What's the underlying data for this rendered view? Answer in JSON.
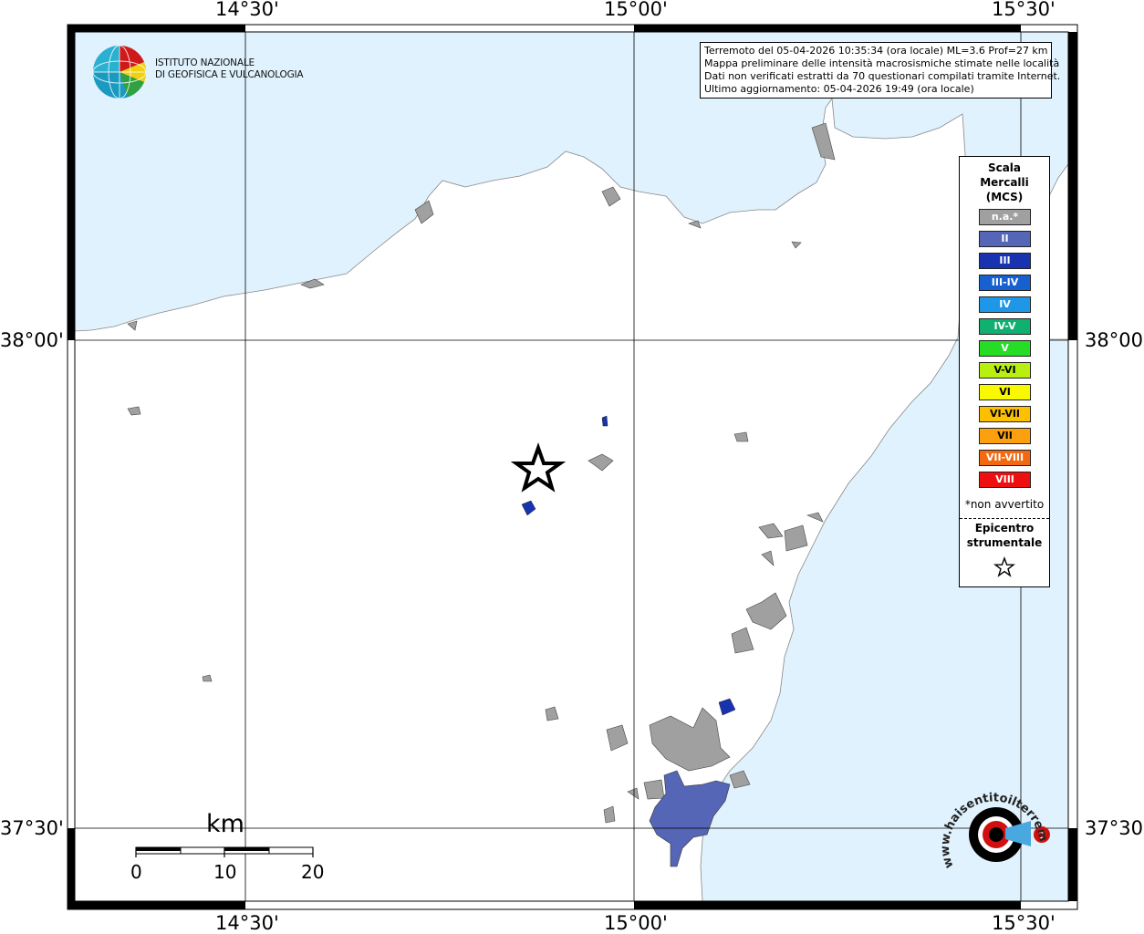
{
  "logo": {
    "line1": "ISTITUTO NAZIONALE",
    "line2": "DI GEOFISICA E VULCANOLOGIA"
  },
  "info": {
    "line1": "Terremoto del 05-04-2026 10:35:34 (ora locale) ML=3.6 Prof=27 km",
    "line2": "Mappa preliminare delle intensità macrosismiche stimate nelle località",
    "line3": "Dati non verificati estratti da 70 questionari compilati tramite Internet.",
    "line4": "Ultimo aggiornamento: 05-04-2026 19:49 (ora locale)"
  },
  "axes": {
    "top": [
      "14°30'",
      "15°00'",
      "15°30'"
    ],
    "bottom": [
      "14°30'",
      "15°00'",
      "15°30'"
    ],
    "left": [
      "38°00'",
      "37°30'"
    ],
    "right": [
      "38°00'",
      "37°30'"
    ]
  },
  "legend": {
    "title1": "Scala",
    "title2": "Mercalli",
    "title3": "(MCS)",
    "items": [
      {
        "label": "n.a.*",
        "color": "#a0a0a0"
      },
      {
        "label": "II",
        "color": "#5466b5"
      },
      {
        "label": "III",
        "color": "#1733b0"
      },
      {
        "label": "III-IV",
        "color": "#1660d0"
      },
      {
        "label": "IV",
        "color": "#1f97e8"
      },
      {
        "label": "IV-V",
        "color": "#10b070"
      },
      {
        "label": "V",
        "color": "#26dd26"
      },
      {
        "label": "V-VI",
        "color": "#b8ee10"
      },
      {
        "label": "VI",
        "color": "#f8f800"
      },
      {
        "label": "VI-VII",
        "color": "#fcc000"
      },
      {
        "label": "VII",
        "color": "#fca010"
      },
      {
        "label": "VII-VIII",
        "color": "#f46810"
      },
      {
        "label": "VIII",
        "color": "#ee1010"
      }
    ],
    "not_felt": "*non avvertito",
    "epicenter1": "Epicentro",
    "epicenter2": "strumentale"
  },
  "scale": {
    "unit": "km",
    "labels": [
      "0",
      "10",
      "20"
    ]
  },
  "watermark": {
    "text": "www.haisentitoilterremoto.it"
  },
  "colors": {
    "sea": "#e0f2fd",
    "land": "#ffffff",
    "not_available": "#a0a0a0",
    "intensity_II": "#5466b5",
    "intensity_III": "#1733b0"
  }
}
